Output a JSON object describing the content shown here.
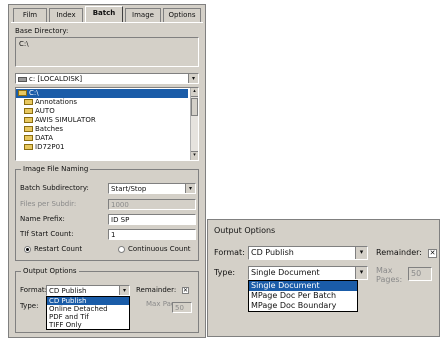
{
  "tabs": [
    "Film",
    "Index",
    "Batch",
    "Image",
    "Options"
  ],
  "active_tab": "Batch",
  "base_directory": {
    "label": "Base Directory:",
    "value": "C:\\"
  },
  "drive": {
    "value": "c: [LOCALDISK]"
  },
  "folders": [
    "C:\\",
    "Annotations",
    "AUTO",
    "AWIS SIMULATOR",
    "Batches",
    "DATA",
    "ID72P01"
  ],
  "image_file_naming": {
    "title": "Image File Naming",
    "batch_subdir_label": "Batch Subdirectory:",
    "batch_subdir_value": "Start/Stop",
    "files_per_subdir_label": "Files per Subdir:",
    "files_per_subdir_value": "1000",
    "name_prefix_label": "Name Prefix:",
    "name_prefix_value": "ID SP",
    "tif_start_label": "TIf Start Count:",
    "tif_start_value": "1",
    "radio_restart": "Restart Count",
    "radio_continuous": "Continuous Count"
  },
  "output_options": {
    "title": "Output Options",
    "format_label": "Format:",
    "format_value": "CD Publish",
    "format_options": [
      "CD Publish",
      "Online Detached",
      "PDF and Tif",
      "TIFF Only"
    ],
    "remainder_label": "Remainder:",
    "remainder_checked": true,
    "type_label": "Type:",
    "max_pages_label": "Max Pages:",
    "max_pages_value": "50"
  },
  "zoom_output": {
    "title": "Output Options",
    "format_label": "Format:",
    "format_value": "CD Publish",
    "remainder_label": "Remainder:",
    "type_label": "Type:",
    "type_value": "Single Document",
    "type_options": [
      "Single Document",
      "MPage Doc Per Batch",
      "MPage Doc Boundary"
    ],
    "max_pages_label": "Max Pages:",
    "max_pages_value": "50"
  },
  "colors": {
    "dialog": "#d4d0c8",
    "selection": "#1a5ca8",
    "folder": "#e8c860"
  }
}
